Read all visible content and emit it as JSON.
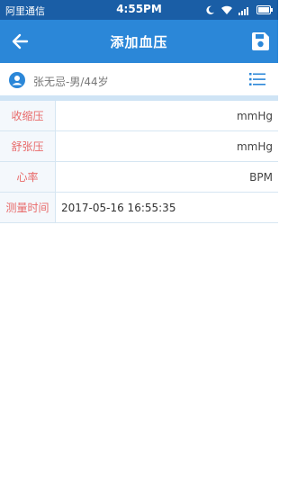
{
  "status": {
    "carrier": "阿里通信",
    "time": "4:55PM"
  },
  "header": {
    "title": "添加血压"
  },
  "patient": {
    "info": "张无忌-男/44岁"
  },
  "form": {
    "rows": [
      {
        "label": "收缩压",
        "value": "",
        "unit": "mmHg"
      },
      {
        "label": "舒张压",
        "value": "",
        "unit": "mmHg"
      },
      {
        "label": "心率",
        "value": "",
        "unit": "BPM"
      },
      {
        "label": "测量时间",
        "value": "2017-05-16 16:55:35",
        "unit": ""
      }
    ]
  },
  "colors": {
    "appbar": "#2b87d8",
    "statusbar": "#1a5ea6",
    "label_text": "#e86a6a"
  }
}
